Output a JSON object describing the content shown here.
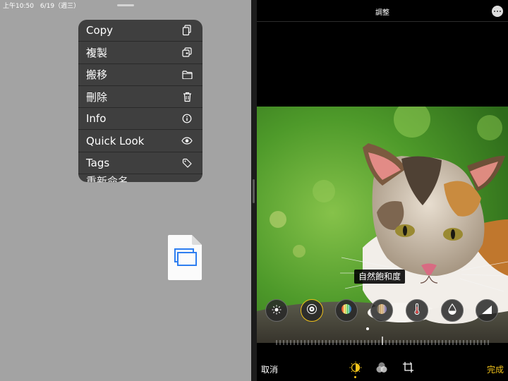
{
  "status_bar": {
    "time_date": "上午10:50　6/19（週三）"
  },
  "context_menu": {
    "items": [
      {
        "label": "Copy",
        "icon": "doc-copy-icon"
      },
      {
        "label": "複製",
        "icon": "duplicate-icon"
      },
      {
        "label": "搬移",
        "icon": "folder-icon"
      },
      {
        "label": "刪除",
        "icon": "trash-icon"
      },
      {
        "label": "Info",
        "icon": "info-icon"
      },
      {
        "label": "Quick Look",
        "icon": "eye-icon"
      },
      {
        "label": "Tags",
        "icon": "tag-icon"
      },
      {
        "label": "重新命名",
        "icon": ""
      }
    ]
  },
  "editor": {
    "title": "調整",
    "adjustment_label": "自然飽和度",
    "cancel_label": "取消",
    "done_label": "完成"
  },
  "colors": {
    "accent": "#f2c31a",
    "menu_bg": "#3f3f3f",
    "left_bg": "#a3a3a3"
  }
}
